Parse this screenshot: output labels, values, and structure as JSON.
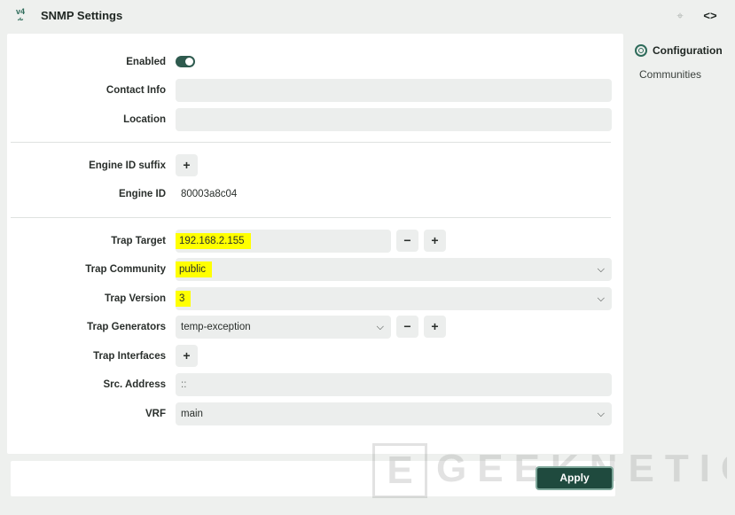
{
  "window": {
    "title": "SNMP Settings",
    "app_icon_text": "v4"
  },
  "form": {
    "enabled": {
      "label": "Enabled",
      "value": true
    },
    "contact_info": {
      "label": "Contact Info",
      "value": ""
    },
    "location": {
      "label": "Location",
      "value": ""
    },
    "engine_id_suffix": {
      "label": "Engine ID suffix",
      "add_label": "+"
    },
    "engine_id": {
      "label": "Engine ID",
      "value": "80003a8c04"
    },
    "trap_target": {
      "label": "Trap Target",
      "value": "192.168.2.155",
      "remove_label": "−",
      "add_label": "+"
    },
    "trap_community": {
      "label": "Trap Community",
      "value": "public"
    },
    "trap_version": {
      "label": "Trap Version",
      "value": "3"
    },
    "trap_generators": {
      "label": "Trap Generators",
      "value": "temp-exception",
      "remove_label": "−",
      "add_label": "+"
    },
    "trap_interfaces": {
      "label": "Trap Interfaces",
      "add_label": "+"
    },
    "src_address": {
      "label": "Src. Address",
      "value": "::"
    },
    "vrf": {
      "label": "VRF",
      "value": "main"
    }
  },
  "sidebar": {
    "items": [
      {
        "label": "Configuration",
        "active": true
      },
      {
        "label": "Communities",
        "active": false
      }
    ]
  },
  "footer": {
    "apply_label": "Apply"
  },
  "watermark": {
    "box_letter": "E",
    "text": "GEEKNETIC"
  },
  "colors": {
    "accent": "#2e5a4e",
    "highlight": "#ffff00",
    "apply_bg": "#1f4a3e"
  }
}
